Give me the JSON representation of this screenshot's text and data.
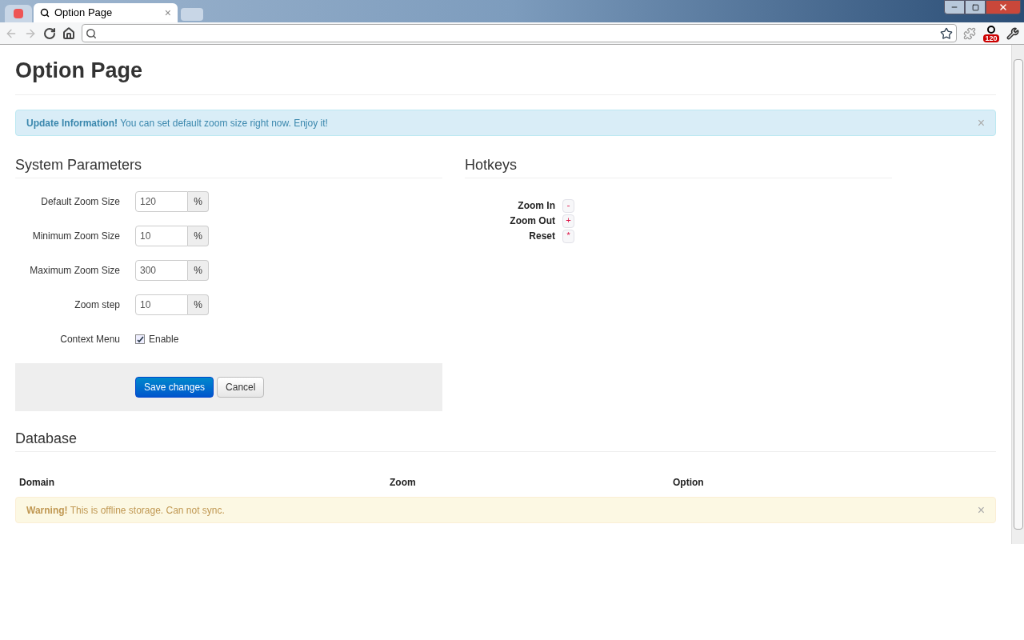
{
  "browser": {
    "tabs": [
      {
        "title": "Option Page",
        "close": "×",
        "selected": true
      }
    ],
    "extension_badge": "120"
  },
  "page": {
    "title": "Option Page",
    "info_alert": {
      "lead": "Update Information!",
      "text": "You can set default zoom size right now. Enjoy it!",
      "close": "×"
    },
    "system_parameters": {
      "heading": "System Parameters",
      "fields": [
        {
          "label": "Default Zoom Size",
          "value": "120",
          "unit": "%"
        },
        {
          "label": "Minimum Zoom Size",
          "value": "10",
          "unit": "%"
        },
        {
          "label": "Maximum Zoom Size",
          "value": "300",
          "unit": "%"
        },
        {
          "label": "Zoom step",
          "value": "10",
          "unit": "%"
        }
      ],
      "context_menu": {
        "label": "Context Menu",
        "option": "Enable",
        "checked": true
      },
      "buttons": [
        {
          "label": "Save changes",
          "kind": "primary"
        },
        {
          "label": "Cancel",
          "kind": "default"
        }
      ]
    },
    "hotkeys": {
      "heading": "Hotkeys",
      "items": [
        {
          "label": "Zoom In",
          "key": "-"
        },
        {
          "label": "Zoom Out",
          "key": "+"
        },
        {
          "label": "Reset",
          "key": "*"
        }
      ]
    },
    "database": {
      "heading": "Database",
      "columns": [
        "Domain",
        "Zoom",
        "Option"
      ],
      "warning_alert": {
        "lead": "Warning!",
        "text": "This is offline storage. Can not sync.",
        "close": "×"
      }
    }
  }
}
